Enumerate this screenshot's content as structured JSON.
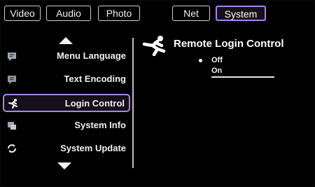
{
  "tabs": [
    {
      "label": "Video",
      "active": false
    },
    {
      "label": "Audio",
      "active": false
    },
    {
      "label": "Photo",
      "active": false
    },
    {
      "label": "Net",
      "active": false
    },
    {
      "label": "System",
      "active": true
    }
  ],
  "menu": {
    "items": [
      {
        "label": "Menu Language",
        "icon": "language-icon"
      },
      {
        "label": "Text Encoding",
        "icon": "encoding-icon"
      },
      {
        "label": "Login Control",
        "icon": "login-runner-icon",
        "selected": true
      },
      {
        "label": "System Info",
        "icon": "info-icon"
      },
      {
        "label": "System Update",
        "icon": "update-icon"
      }
    ]
  },
  "panel": {
    "title": "Remote Login Control",
    "options": [
      {
        "label": "Off",
        "selected": true
      },
      {
        "label": "On",
        "selected": false
      }
    ]
  },
  "colors": {
    "accent": "#a884f0",
    "background": "#000000",
    "text": "#ffffff"
  }
}
